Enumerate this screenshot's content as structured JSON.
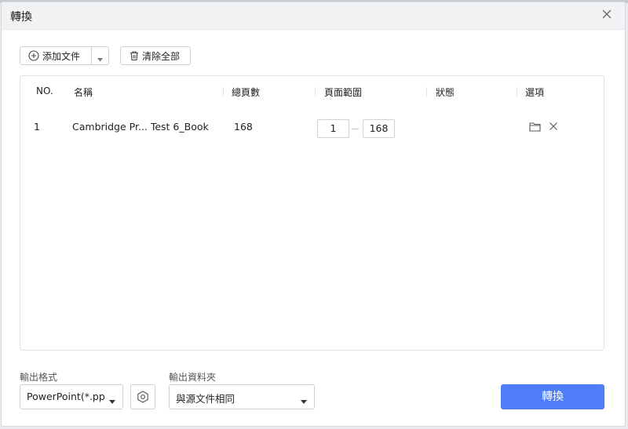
{
  "dialog": {
    "title": "轉換"
  },
  "toolbar": {
    "add_file_label": "添加文件",
    "clear_all_label": "清除全部"
  },
  "table": {
    "headers": {
      "no": "NO.",
      "name": "名稱",
      "total_pages": "總頁數",
      "page_range": "頁面範圍",
      "status": "狀態",
      "options": "選項"
    },
    "rows": [
      {
        "no": "1",
        "name": "Cambridge Pr... Test 6_Book",
        "total_pages": "168",
        "range_from": "1",
        "range_to": "168",
        "status": ""
      }
    ]
  },
  "output": {
    "format_label": "輸出格式",
    "format_value": "PowerPoint(*.ppt",
    "folder_label": "輸出資料夾",
    "folder_value": "與源文件相同"
  },
  "convert_button_label": "轉換",
  "colors": {
    "accent": "#4f7cf7",
    "titlebar": "#f1f2f4",
    "border": "#cdd0d5"
  }
}
